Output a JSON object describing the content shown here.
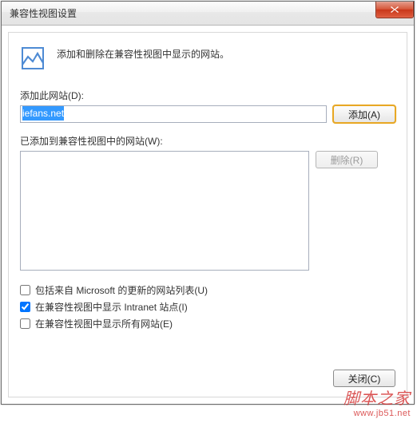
{
  "window": {
    "title": "兼容性视图设置"
  },
  "header": {
    "description": "添加和删除在兼容性视图中显示的网站。"
  },
  "add_section": {
    "label": "添加此网站(D):",
    "input_value": "iefans.net",
    "add_button": "添加(A)"
  },
  "list_section": {
    "label": "已添加到兼容性视图中的网站(W):",
    "remove_button": "删除(R)",
    "items": []
  },
  "checkboxes": {
    "ms_list": {
      "label": "包括来自 Microsoft 的更新的网站列表(U)",
      "checked": false
    },
    "intranet": {
      "label": "在兼容性视图中显示 Intranet 站点(I)",
      "checked": true
    },
    "all_sites": {
      "label": "在兼容性视图中显示所有网站(E)",
      "checked": false
    }
  },
  "footer": {
    "close_button": "关闭(C)"
  },
  "watermark": {
    "text": "脚本之家",
    "url": "www.jb51.net"
  }
}
